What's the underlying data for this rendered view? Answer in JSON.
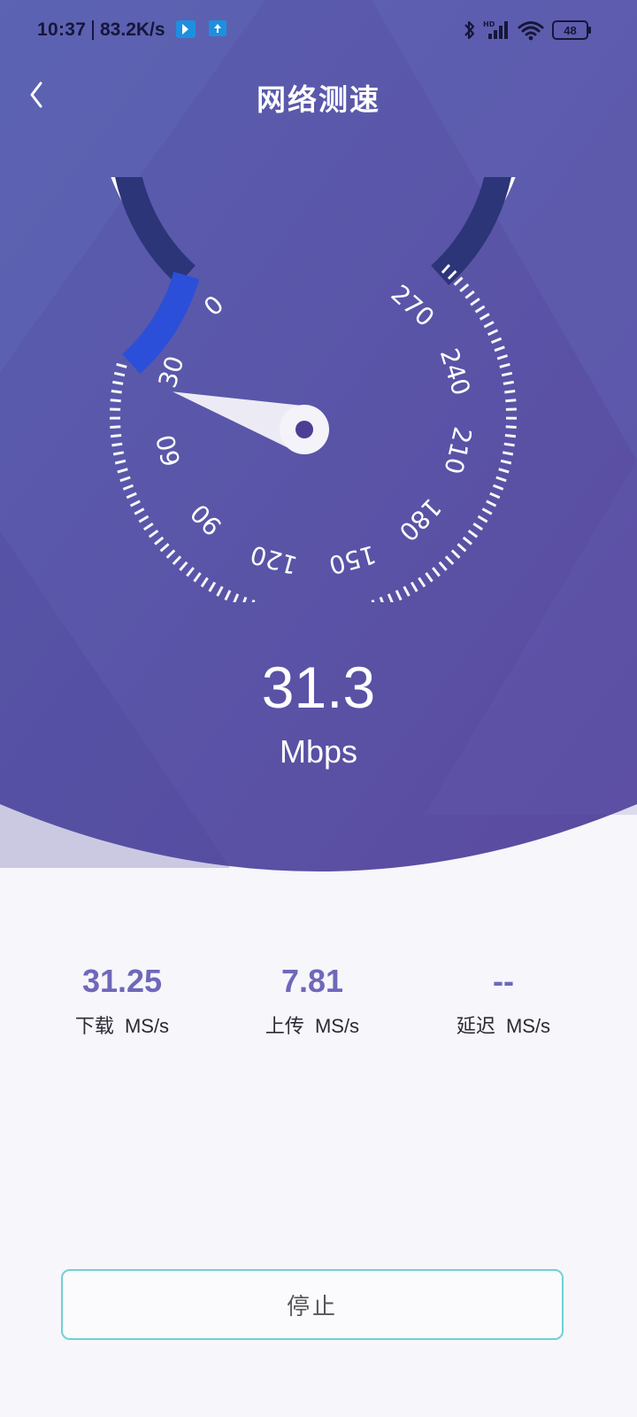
{
  "colors": {
    "header_purple": "#5b4fa3",
    "page_background": "#f6f6fb",
    "gauge_progress_blue": "#2c4fd9",
    "stat_value_purple": "#6f68b9",
    "button_border_teal": "#6ed2d2"
  },
  "status_bar": {
    "time": "10:37",
    "net_speed": "83.2K/s",
    "battery": "48",
    "icons": [
      "bluetooth-icon",
      "hd-signal-icon",
      "wifi-icon",
      "battery-icon"
    ]
  },
  "header": {
    "back_icon": "chevron-left-icon",
    "title": "网络测速"
  },
  "gauge": {
    "ticks": [
      "0",
      "30",
      "60",
      "90",
      "120",
      "150",
      "180",
      "210",
      "240",
      "270"
    ],
    "max": 270,
    "needle_value": 31.3
  },
  "result": {
    "value": "31.3",
    "unit": "Mbps"
  },
  "stats": [
    {
      "value": "31.25",
      "label": "下载",
      "unit": "MS/s"
    },
    {
      "value": "7.81",
      "label": "上传",
      "unit": "MS/s"
    },
    {
      "value": "--",
      "label": "延迟",
      "unit": "MS/s"
    }
  ],
  "stop_button": {
    "label": "停止"
  }
}
